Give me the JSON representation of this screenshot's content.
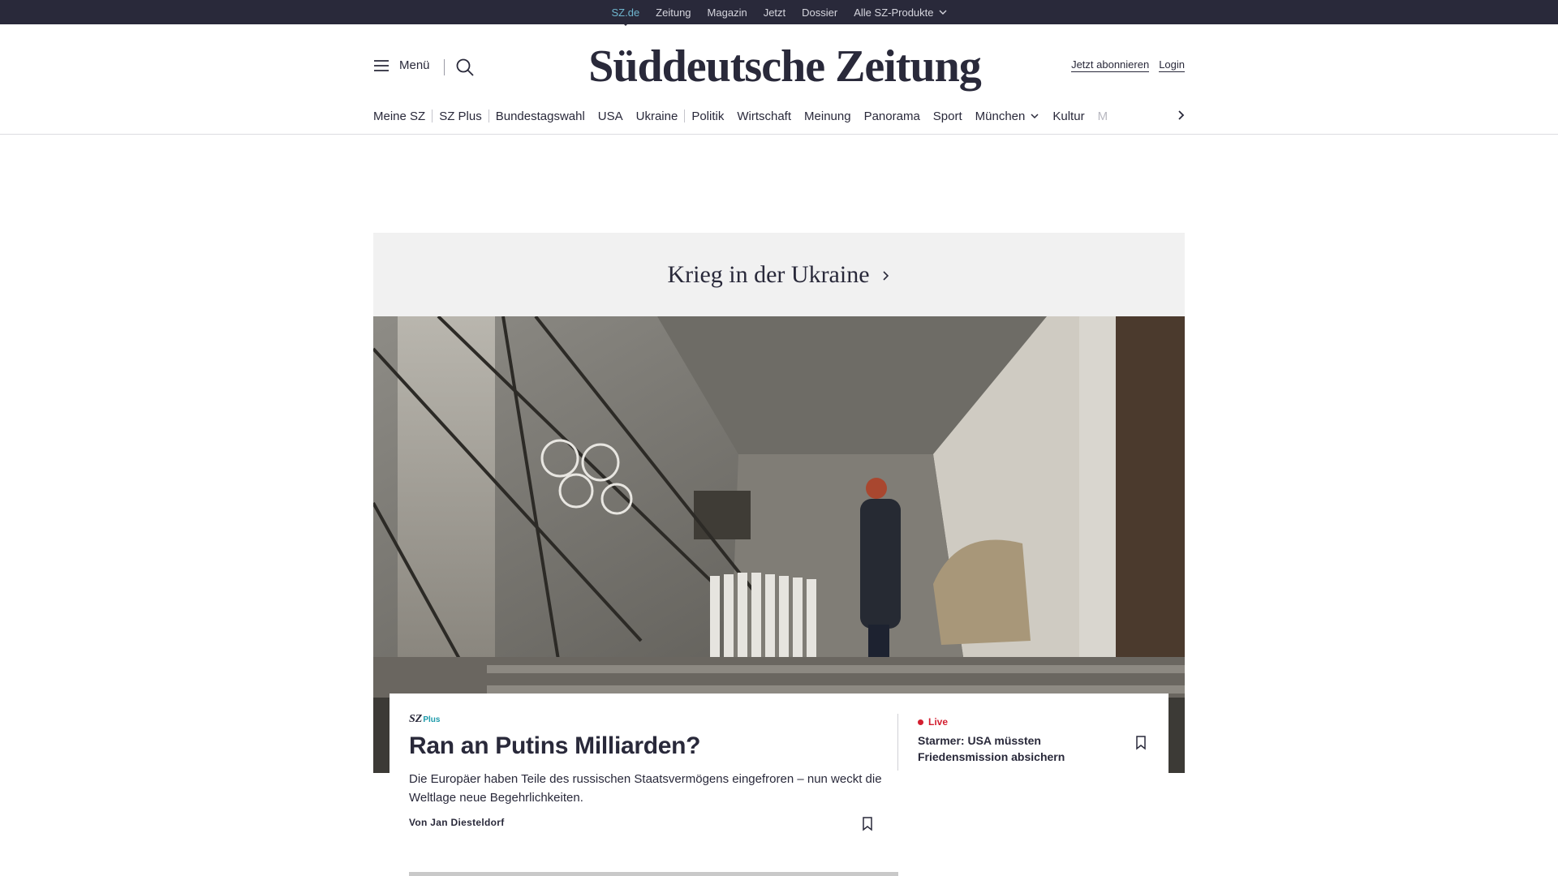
{
  "topbar": {
    "items": [
      "SZ.de",
      "Zeitung",
      "Magazin",
      "Jetzt",
      "Dossier",
      "Alle SZ-Produkte"
    ]
  },
  "header": {
    "menu_label": "Menü",
    "logo": "Süddeutsche Zeitung",
    "subscribe_label": "Jetzt abonnieren",
    "login_label": "Login"
  },
  "nav": {
    "items": [
      "Meine SZ",
      "SZ Plus",
      "Bundestagswahl",
      "USA",
      "Ukraine",
      "Politik",
      "Wirtschaft",
      "Meinung",
      "Panorama",
      "Sport",
      "München",
      "Kultur",
      "M"
    ]
  },
  "section": {
    "title": "Krieg in der Ukraine"
  },
  "lead": {
    "badge_sz": "SZ",
    "badge_plus": "Plus",
    "headline": "Ran an Putins Milliarden?",
    "teaser": "Die Europäer haben Teile des russischen Staatsvermögens eingefroren – nun weckt die Weltlage neue Begehrlichkeiten.",
    "byline": "Von Jan Diesteldorf"
  },
  "live": {
    "label": "Live",
    "headline": "Starmer: USA müssten Friedensmission absichern"
  },
  "colors": {
    "topbar": "#29293a",
    "active_link": "#6fb6cf",
    "live_red": "#d31f30",
    "plus_teal": "#1b9aaa"
  }
}
